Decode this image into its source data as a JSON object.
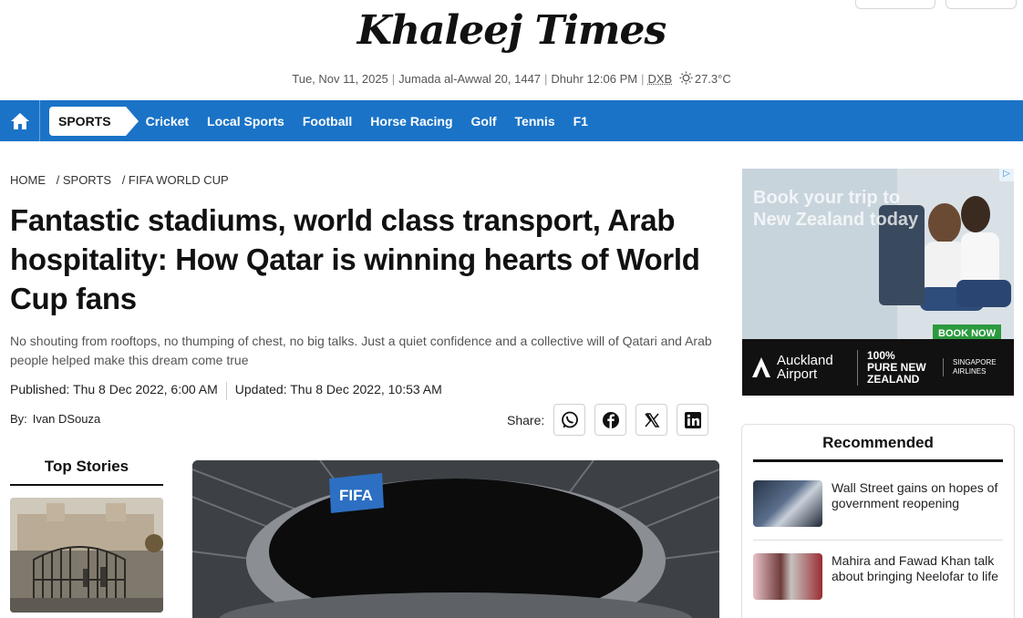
{
  "site": {
    "logo_text": "Khaleej Times"
  },
  "dateline": {
    "date": "Tue, Nov 11, 2025",
    "hijri": "Jumada al-Awwal 20, 1447",
    "prayer": "Dhuhr 12:06 PM",
    "city": "DXB",
    "temperature": "27.3°C"
  },
  "nav": {
    "section": "SPORTS",
    "links": [
      "Cricket",
      "Local Sports",
      "Football",
      "Horse Racing",
      "Golf",
      "Tennis",
      "F1"
    ],
    "accent": "#1a73c7"
  },
  "breadcrumb": [
    "HOME",
    "/ SPORTS",
    "/ FIFA WORLD CUP"
  ],
  "article": {
    "headline": "Fantastic stadiums, world class transport, Arab hospitality: How Qatar is winning hearts of World Cup fans",
    "summary": "No shouting from rooftops, no thumping of chest, no big talks. Just a quiet confidence and a collective will of Qatari and Arab people helped make this dream come true",
    "published": "Published: Thu 8 Dec 2022, 6:00 AM",
    "updated": "Updated: Thu 8 Dec 2022, 10:53 AM",
    "author_label": "By:",
    "author_name": "Ivan DSouza",
    "share_label": "Share:",
    "share_icons": [
      "whatsapp-icon",
      "facebook-icon",
      "x-icon",
      "linkedin-icon"
    ],
    "hero_sign": "FIFA"
  },
  "top_stories": {
    "title": "Top Stories"
  },
  "ad": {
    "title": "Book your trip to New Zealand today",
    "cta": "BOOK NOW",
    "sponsor_1": "Auckland Airport",
    "sponsor_2": "100% PURE NEW ZEALAND",
    "sponsor_3": "SINGAPORE AIRLINES"
  },
  "recommended": {
    "title": "Recommended",
    "items": [
      {
        "title": "Wall Street gains on hopes of government reopening"
      },
      {
        "title": "Mahira and Fawad Khan talk about bringing Neelofar to life"
      }
    ]
  }
}
